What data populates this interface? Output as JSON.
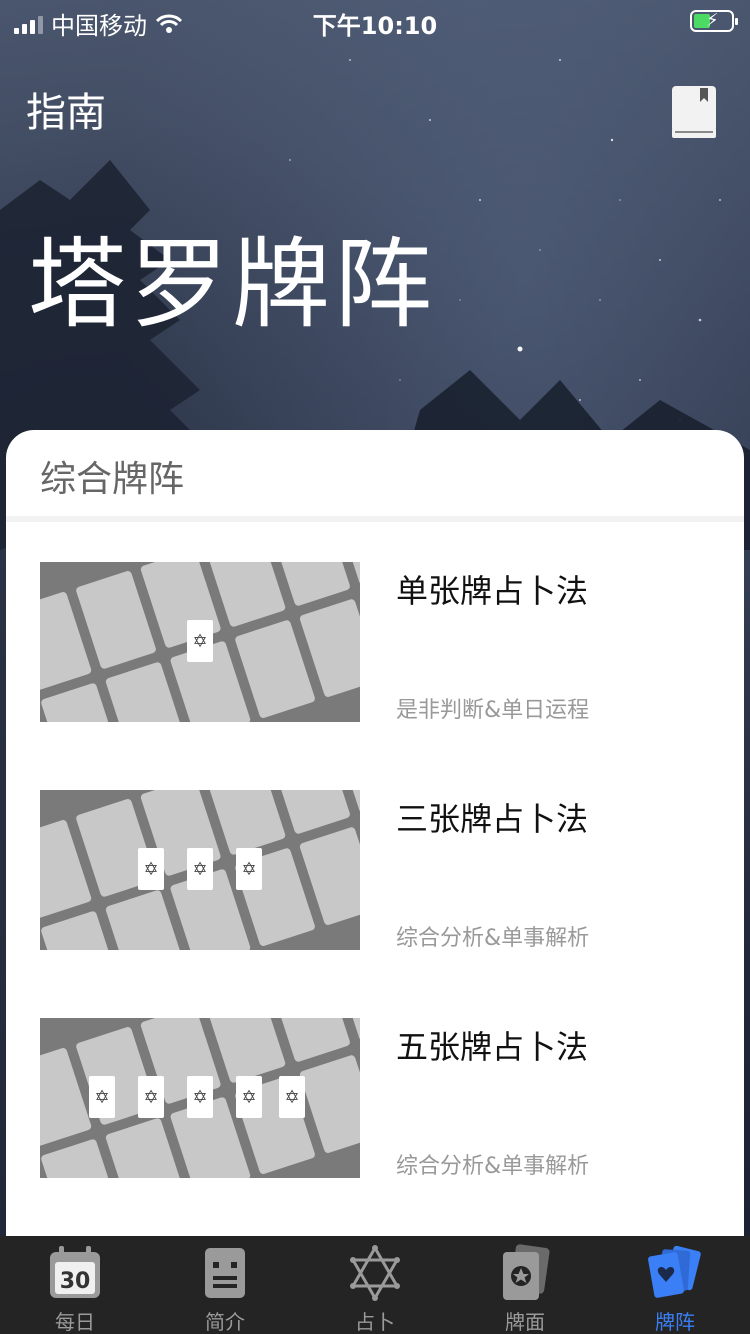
{
  "status_bar": {
    "carrier": "中国移动",
    "time": "下午10:10"
  },
  "header": {
    "nav_title": "指南",
    "page_title": "塔罗牌阵"
  },
  "section": {
    "title": "综合牌阵",
    "spreads": [
      {
        "title": "单张牌占卜法",
        "subtitle": "是非判断&单日运程",
        "card_count": 1
      },
      {
        "title": "三张牌占卜法",
        "subtitle": "综合分析&单事解析",
        "card_count": 3
      },
      {
        "title": "五张牌占卜法",
        "subtitle": "综合分析&单事解析",
        "card_count": 5
      }
    ]
  },
  "tab_bar": {
    "items": [
      {
        "label": "每日",
        "icon": "calendar-icon",
        "badge": "30"
      },
      {
        "label": "简介",
        "icon": "document-icon"
      },
      {
        "label": "占卜",
        "icon": "hexagram-icon"
      },
      {
        "label": "牌面",
        "icon": "card-face-icon"
      },
      {
        "label": "牌阵",
        "icon": "card-spread-icon",
        "active": true
      }
    ],
    "active_color": "#3a7ff6"
  }
}
